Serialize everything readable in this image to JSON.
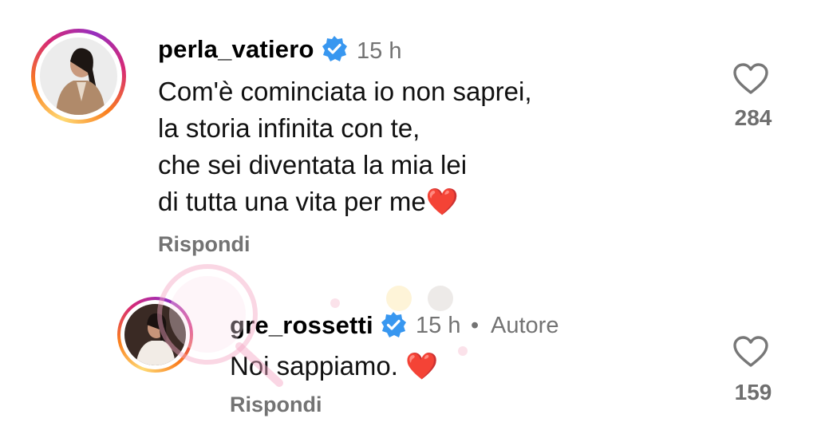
{
  "comments": [
    {
      "username": "perla_vatiero",
      "verified": true,
      "time": "15 h",
      "text": "Com'è cominciata io non saprei,\nla storia infinita con te,\nche sei diventata la mia lei\ndi tutta una vita per me❤️",
      "reply_label": "Rispondi",
      "likes": "284",
      "like_icon": "heart-outline-icon"
    },
    {
      "username": "gre_rossetti",
      "verified": true,
      "time": "15 h",
      "separator": "•",
      "author_label": "Autore",
      "text": "Noi sappiamo. ❤️",
      "reply_label": "Rispondi",
      "likes": "159",
      "like_icon": "heart-outline-icon"
    }
  ],
  "colors": {
    "verified_blue": "#3897f0",
    "meta_gray": "#737373",
    "ring_gradient": [
      "#feda75",
      "#fa7e1e",
      "#d62976",
      "#962fbf"
    ]
  }
}
